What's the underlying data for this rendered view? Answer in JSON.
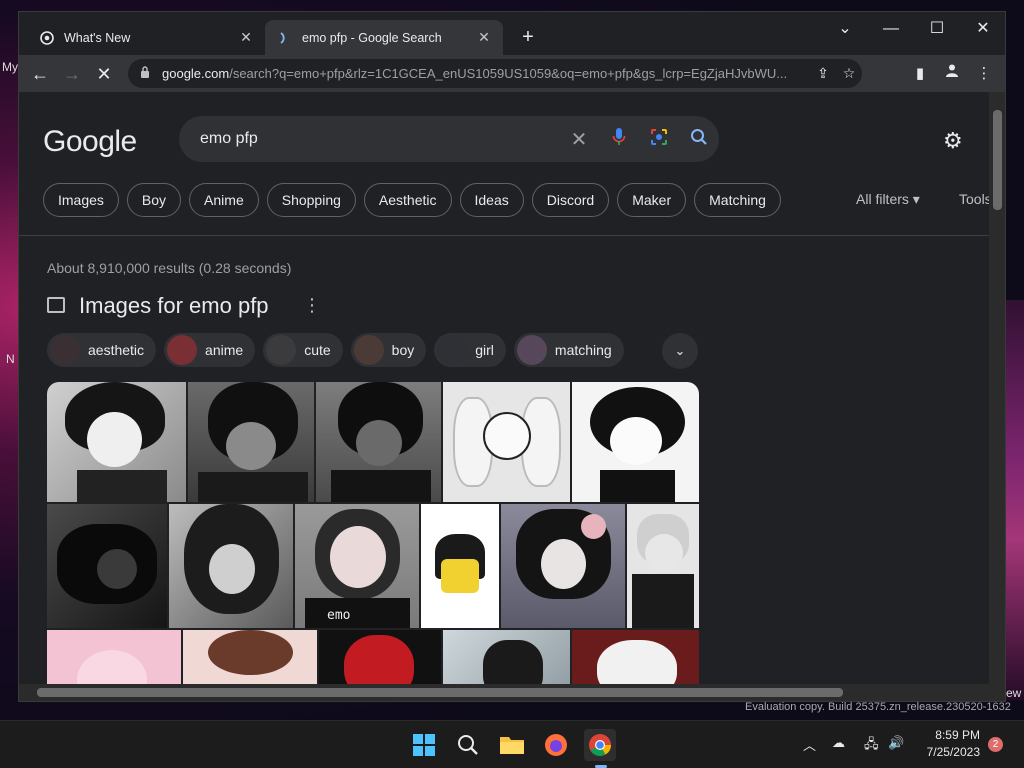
{
  "desktop": {
    "left_labels": [
      "My",
      "N"
    ],
    "right_label": "ew",
    "watermark": "Evaluation copy. Build 25375.zn_release.230520-1632"
  },
  "browser": {
    "tabs": [
      {
        "label": "What's New",
        "icon": "chrome-icon",
        "close": "✕"
      },
      {
        "label": "emo pfp - Google Search",
        "icon": "google-g-icon",
        "close": "✕"
      }
    ],
    "new_tab": "+",
    "window_controls": {
      "tab_search": "⌄",
      "minimize": "—",
      "maximize": "☐",
      "close": "✕"
    },
    "url_host": "google.com",
    "url_rest": "/search?q=emo+pfp&rlz=1C1GCEA_enUS1059US1059&oq=emo+pfp&gs_lcrp=EgZjaHJvbWU..."
  },
  "search": {
    "logo": "Google",
    "query": "emo pfp",
    "chips": [
      "Images",
      "Boy",
      "Anime",
      "Shopping",
      "Aesthetic",
      "Ideas",
      "Discord",
      "Maker",
      "Matching"
    ],
    "all_filters": "All filters",
    "tools": "Tools",
    "results_count": "About 8,910,000 results (0.28 seconds)",
    "images_heading": "Images for emo pfp",
    "refinements": [
      {
        "label": "aesthetic",
        "color": "#3a3034"
      },
      {
        "label": "anime",
        "color": "#7a2f34"
      },
      {
        "label": "cute",
        "color": "#3b3b3d"
      },
      {
        "label": "boy",
        "color": "#4a3b36"
      },
      {
        "label": "girl",
        "color": "#2f3036"
      },
      {
        "label": "matching",
        "color": "#56475a"
      }
    ]
  },
  "taskbar": {
    "time": "8:59 PM",
    "date": "7/25/2023",
    "notifications": "2"
  }
}
